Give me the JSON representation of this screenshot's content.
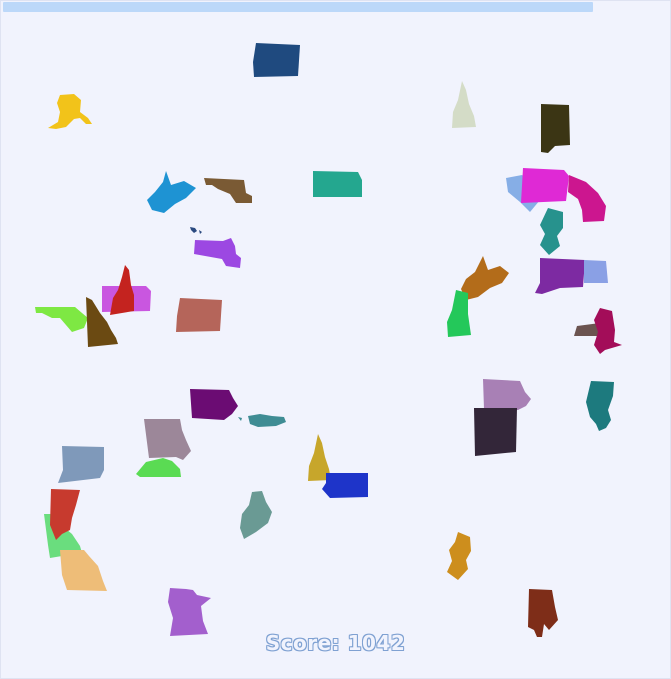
{
  "score": {
    "label": "Score: 1042"
  },
  "pieces": [
    {
      "name": "oregon-piece",
      "color": "#1f4a7f"
    },
    {
      "name": "alaska-piece",
      "color": "#f2c31a"
    },
    {
      "name": "new-hampshire-piece",
      "color": "#d4dcc7"
    },
    {
      "name": "alabama-piece",
      "color": "#3b3514"
    },
    {
      "name": "west-virginia-piece",
      "color": "#1e93d3"
    },
    {
      "name": "nebraska-piece",
      "color": "#7a5a34"
    },
    {
      "name": "kansas-piece",
      "color": "#24a78f"
    },
    {
      "name": "south-carolina-piece",
      "color": "#86aee6"
    },
    {
      "name": "pennsylvania-piece",
      "color": "#df29d5"
    },
    {
      "name": "north-carolina-piece",
      "color": "#cc168f"
    },
    {
      "name": "new-jersey-piece",
      "color": "#27928d"
    },
    {
      "name": "hawaii-piece",
      "color": "#2b4a80"
    },
    {
      "name": "massachusetts-piece",
      "color": "#9c48e2"
    },
    {
      "name": "west-virginia-piece-2",
      "color": "#b36c1a"
    },
    {
      "name": "connecticut-piece",
      "color": "#7d2aa2"
    },
    {
      "name": "rhode-island-piece",
      "color": "#8aa0e5"
    },
    {
      "name": "vermont-piece",
      "color": "#24c85a"
    },
    {
      "name": "pennsylvania-piece-2",
      "color": "#c956e0"
    },
    {
      "name": "new-hampshire-piece-2",
      "color": "#c4231f"
    },
    {
      "name": "maryland-piece",
      "color": "#7ee843"
    },
    {
      "name": "idaho-piece",
      "color": "#6b4a12"
    },
    {
      "name": "oregon-piece-2",
      "color": "#b5655a"
    },
    {
      "name": "maryland-piece-2",
      "color": "#6b5350"
    },
    {
      "name": "virginia-piece",
      "color": "#a30d59"
    },
    {
      "name": "iowa-piece",
      "color": "#6b0c73"
    },
    {
      "name": "hawaii-piece-2",
      "color": "#3f8c94"
    },
    {
      "name": "iowa-piece-2",
      "color": "#a880b5"
    },
    {
      "name": "illinois-piece",
      "color": "#1d7a7e"
    },
    {
      "name": "missouri-piece",
      "color": "#9c8799"
    },
    {
      "name": "virginia-piece-2",
      "color": "#5adb53"
    },
    {
      "name": "colorado-piece",
      "color": "#332639"
    },
    {
      "name": "colorado-piece-2",
      "color": "#7f99ba"
    },
    {
      "name": "new-hampshire-piece-3",
      "color": "#c7a62b"
    },
    {
      "name": "colorado-piece-3",
      "color": "#1e34c9"
    },
    {
      "name": "california-piece",
      "color": "#6add7e"
    },
    {
      "name": "idaho-piece-2",
      "color": "#c73a2e"
    },
    {
      "name": "maine-piece",
      "color": "#6a9a94"
    },
    {
      "name": "missouri-piece-2",
      "color": "#eebd78"
    },
    {
      "name": "new-jersey-piece-2",
      "color": "#cd8e1d"
    },
    {
      "name": "minnesota-piece",
      "color": "#a35fcd"
    },
    {
      "name": "alabama-piece-2",
      "color": "#7e2d18"
    }
  ]
}
